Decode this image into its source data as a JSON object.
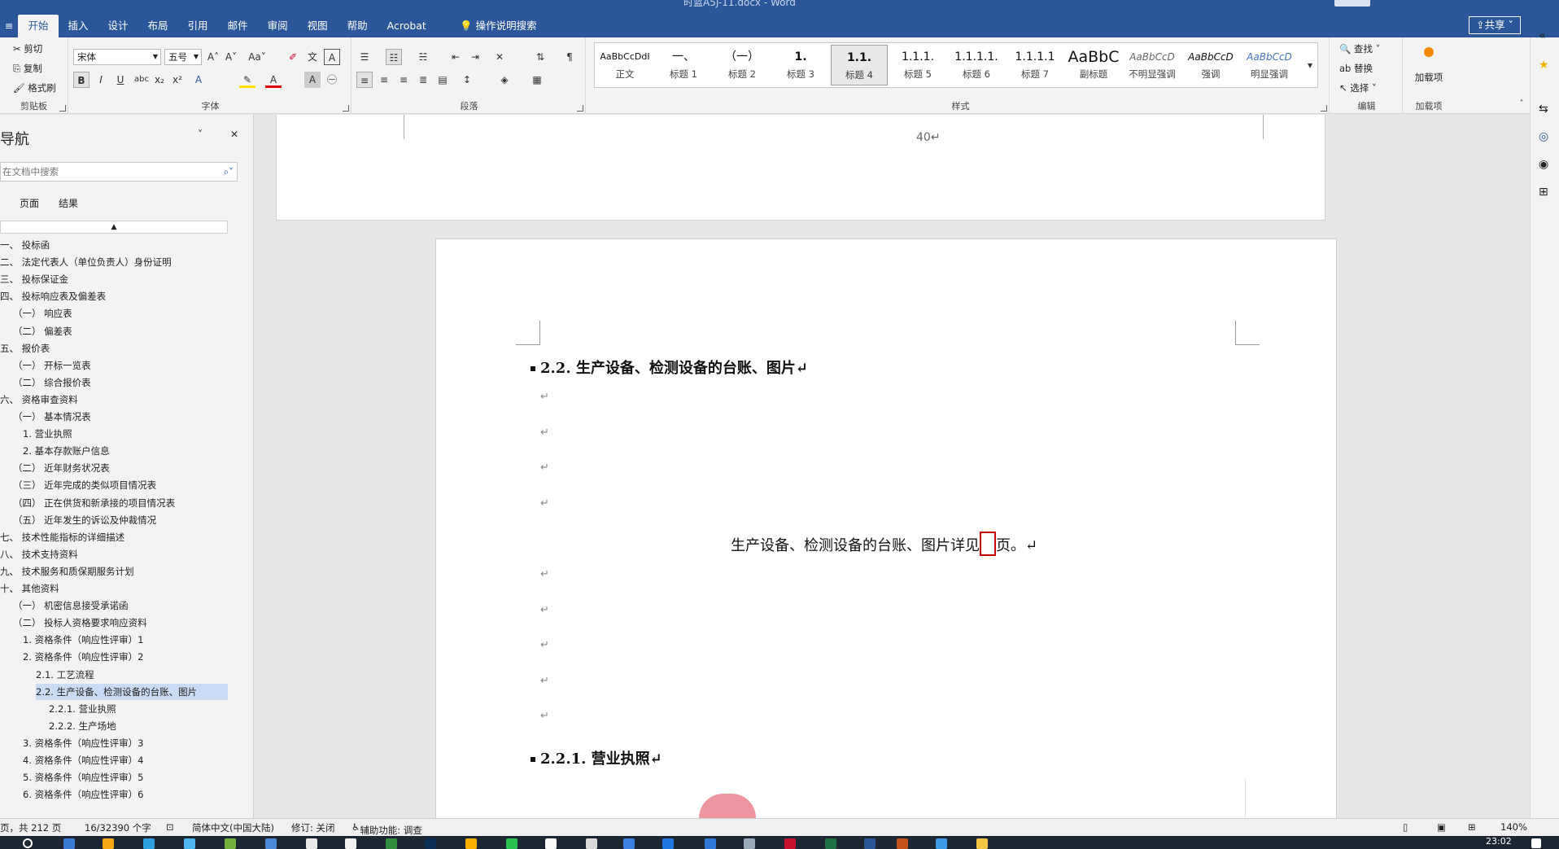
{
  "title_bar": {
    "document_title": "时蓝A5J-11.docx - Word"
  },
  "ribbon_tabs": [
    "开始",
    "插入",
    "设计",
    "布局",
    "引用",
    "邮件",
    "审阅",
    "视图",
    "帮助",
    "Acrobat"
  ],
  "tell_me": "操作说明搜索",
  "share_label": "共享",
  "clipboard": {
    "cut": "剪切",
    "copy": "复制",
    "format_painter": "格式刷",
    "label": "剪贴板"
  },
  "font_group": {
    "font_name": "宋体",
    "font_size": "五号",
    "label": "字体"
  },
  "paragraph_group": {
    "label": "段落"
  },
  "styles_group": {
    "label": "样式",
    "items": [
      {
        "preview": "AaBbCcDdI",
        "name": "正文"
      },
      {
        "preview": "一、",
        "name": "标题 1"
      },
      {
        "preview": "（一）",
        "name": "标题 2"
      },
      {
        "preview": "1.",
        "name": "标题 3"
      },
      {
        "preview": "1.1.",
        "name": "标题 4"
      },
      {
        "preview": "1.1.1.",
        "name": "标题 5"
      },
      {
        "preview": "1.1.1.1.",
        "name": "标题 6"
      },
      {
        "preview": "1.1.1.1",
        "name": "标题 7"
      },
      {
        "preview": "AaBbC",
        "name": "副标题"
      },
      {
        "preview": "AaBbCcD",
        "name": "不明显强调"
      },
      {
        "preview": "AaBbCcD",
        "name": "强调"
      },
      {
        "preview": "AaBbCcD",
        "name": "明显强调"
      }
    ]
  },
  "editing_group": {
    "find": "查找",
    "replace": "替换",
    "select": "选择",
    "label": "编辑"
  },
  "addins_group": {
    "button": "加载项",
    "label": "加载项"
  },
  "nav_pane": {
    "title": "导航",
    "search_placeholder": "在文档中搜索",
    "tabs": [
      "页面",
      "结果"
    ],
    "items": [
      {
        "text": "一、  投标函",
        "indent": 0
      },
      {
        "text": "二、  法定代表人（单位负责人）身份证明",
        "indent": 0
      },
      {
        "text": "三、  投标保证金",
        "indent": 0
      },
      {
        "text": "四、  投标响应表及偏差表",
        "indent": 0
      },
      {
        "text": "（一）  响应表",
        "indent": 1
      },
      {
        "text": "（二）  偏差表",
        "indent": 1
      },
      {
        "text": "五、  报价表",
        "indent": 0
      },
      {
        "text": "（一）  开标一览表",
        "indent": 1
      },
      {
        "text": "（二）  综合报价表",
        "indent": 1
      },
      {
        "text": "六、  资格审查资料",
        "indent": 0
      },
      {
        "text": "（一）  基本情况表",
        "indent": 1
      },
      {
        "text": "1. 营业执照",
        "indent": 2
      },
      {
        "text": "2. 基本存款账户信息",
        "indent": 2
      },
      {
        "text": "（二）  近年财务状况表",
        "indent": 1
      },
      {
        "text": "（三）  近年完成的类似项目情况表",
        "indent": 1
      },
      {
        "text": "（四）  正在供货和新承接的项目情况表",
        "indent": 1
      },
      {
        "text": "（五）  近年发生的诉讼及仲裁情况",
        "indent": 1
      },
      {
        "text": "七、  技术性能指标的详细描述",
        "indent": 0
      },
      {
        "text": "八、  技术支持资料",
        "indent": 0
      },
      {
        "text": "九、  技术服务和质保期服务计划",
        "indent": 0
      },
      {
        "text": "十、  其他资料",
        "indent": 0
      },
      {
        "text": "（一）  机密信息接受承诺函",
        "indent": 1
      },
      {
        "text": "（二）  投标人资格要求响应资料",
        "indent": 1
      },
      {
        "text": "1. 资格条件（响应性评审）1",
        "indent": 2
      },
      {
        "text": "2. 资格条件（响应性评审）2",
        "indent": 2
      },
      {
        "text": "2.1. 工艺流程",
        "indent": 3
      },
      {
        "text": "2.2. 生产设备、检测设备的台账、图片",
        "indent": 3
      },
      {
        "text": "2.2.1. 营业执照",
        "indent": 4
      },
      {
        "text": "2.2.2. 生产场地",
        "indent": 4
      },
      {
        "text": "3. 资格条件（响应性评审）3",
        "indent": 2
      },
      {
        "text": "4. 资格条件（响应性评审）4",
        "indent": 2
      },
      {
        "text": "5. 资格条件（响应性评审）5",
        "indent": 2
      },
      {
        "text": "6. 资格条件（响应性评审）6",
        "indent": 2
      }
    ]
  },
  "document": {
    "prev_page_number": "40↵",
    "heading_2_2": "2.2. 生产设备、检测设备的台账、图片↵",
    "para_mark": "↵",
    "body_text_before": "生产设备、检测设备的台账、图片详见",
    "body_text_after": "页。↵",
    "heading_2_2_1": "2.2.1. 营业执照↵"
  },
  "status_bar": {
    "page": "页，共 212 页",
    "words": "16/32390 个字",
    "language": "简体中文(中国大陆)",
    "track_changes": "修订: 关闭",
    "accessibility": "辅助功能: 调查",
    "zoom": "140%"
  },
  "taskbar": {
    "time": "23:02"
  }
}
